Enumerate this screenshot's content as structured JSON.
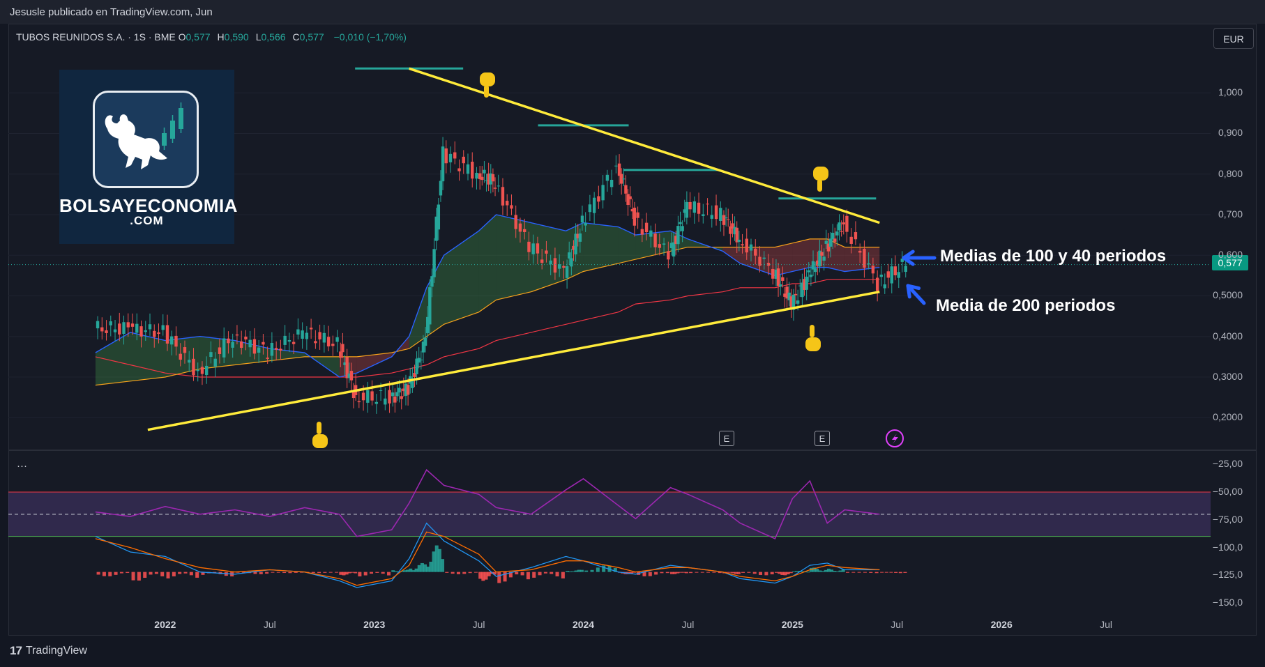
{
  "header": {
    "published": "Jesusle publicado en TradingView.com, Jun",
    "symbol": "TUBOS REUNIDOS S.A. · 1S · BME",
    "ohlc": [
      {
        "label": "O",
        "value": "0,577"
      },
      {
        "label": "H",
        "value": "0,590"
      },
      {
        "label": "L",
        "value": "0,566"
      },
      {
        "label": "C",
        "value": "0,577"
      }
    ],
    "change": "−0,010 (−1,70%)",
    "currency": "EUR"
  },
  "logo": {
    "main": "BOLSAYECONOMIA",
    "sub": ".COM"
  },
  "annotations": {
    "ma_100_40": "Medias de 100 y 40 periodos",
    "ma_200": "Media de 200 periodos"
  },
  "price_badge": "0,577",
  "earnings_marker": "E",
  "footer": {
    "brand": "TradingView"
  },
  "colors": {
    "up": "#26a69a",
    "down": "#ef5350",
    "trendline": "#ffeb3b",
    "ma40": "#2962ff",
    "ma100": "#f7a21b",
    "ma200": "#f23645",
    "rsi": "#9c27b0",
    "macd": "#2196f3",
    "signal": "#ff6d00",
    "annotation_arrow": "#2962ff",
    "resistance": "#26a69a"
  },
  "icons": [
    "bull-logo-icon",
    "pointing-up-hand-icon",
    "pointing-down-hand-icon",
    "arrow-left-icon",
    "lightning-icon",
    "tradingview-logo-icon"
  ],
  "chart_data": [
    {
      "type": "candlestick",
      "timeframe": "1S",
      "price_axis": {
        "ticks": [
          "0,2000",
          "0,3000",
          "0,4000",
          "0,5000",
          "0,600",
          "0,700",
          "0,800",
          "0,900",
          "1,000"
        ],
        "range": [
          0.13,
          1.1
        ]
      },
      "time_axis": {
        "labels": [
          {
            "text": "2022",
            "bold": true
          },
          {
            "text": "Jul",
            "bold": false
          },
          {
            "text": "2023",
            "bold": true
          },
          {
            "text": "Jul",
            "bold": false
          },
          {
            "text": "2024",
            "bold": true
          },
          {
            "text": "Jul",
            "bold": false
          },
          {
            "text": "2025",
            "bold": true
          },
          {
            "text": "Jul",
            "bold": false
          },
          {
            "text": "2026",
            "bold": true
          },
          {
            "text": "Jul",
            "bold": false
          }
        ]
      },
      "series": [
        {
          "name": "Close",
          "x": [
            "2021-09",
            "2021-11",
            "2022-01",
            "2022-03",
            "2022-05",
            "2022-07",
            "2022-09",
            "2022-11",
            "2022-12",
            "2023-02",
            "2023-03",
            "2023-04",
            "2023-05",
            "2023-07",
            "2023-08",
            "2023-10",
            "2023-12",
            "2024-01",
            "2024-03",
            "2024-04",
            "2024-06",
            "2024-07",
            "2024-09",
            "2024-10",
            "2024-12",
            "2025-01",
            "2025-02",
            "2025-03",
            "2025-04",
            "2025-06"
          ],
          "values": [
            0.42,
            0.41,
            0.31,
            0.4,
            0.36,
            0.41,
            0.38,
            0.25,
            0.25,
            0.27,
            0.39,
            0.85,
            0.8,
            0.78,
            0.62,
            0.56,
            0.68,
            0.82,
            0.69,
            0.6,
            0.72,
            0.7,
            0.64,
            0.56,
            0.48,
            0.55,
            0.62,
            0.68,
            0.53,
            0.58
          ]
        }
      ],
      "moving_averages": [
        {
          "period": 40,
          "values": [
            0.36,
            0.41,
            0.39,
            0.4,
            0.39,
            0.37,
            0.36,
            0.3,
            0.31,
            0.35,
            0.4,
            0.52,
            0.6,
            0.66,
            0.7,
            0.68,
            0.66,
            0.68,
            0.67,
            0.65,
            0.66,
            0.64,
            0.61,
            0.58,
            0.55,
            0.56,
            0.57,
            0.57,
            0.56,
            0.57
          ]
        },
        {
          "period": 100,
          "values": [
            0.28,
            0.29,
            0.3,
            0.32,
            0.33,
            0.34,
            0.35,
            0.35,
            0.35,
            0.36,
            0.37,
            0.4,
            0.43,
            0.46,
            0.49,
            0.51,
            0.54,
            0.56,
            0.58,
            0.59,
            0.61,
            0.62,
            0.62,
            0.62,
            0.62,
            0.63,
            0.64,
            0.64,
            0.62,
            0.62
          ]
        },
        {
          "period": 200,
          "values": [
            0.35,
            0.33,
            0.31,
            0.3,
            0.3,
            0.3,
            0.3,
            0.3,
            0.3,
            0.31,
            0.32,
            0.33,
            0.35,
            0.37,
            0.39,
            0.41,
            0.43,
            0.44,
            0.46,
            0.48,
            0.49,
            0.5,
            0.51,
            0.52,
            0.52,
            0.53,
            0.53,
            0.54,
            0.54,
            0.54
          ]
        }
      ],
      "trendlines": [
        {
          "from": [
            "2023-03",
            1.06
          ],
          "to": [
            "2025-06",
            0.68
          ]
        },
        {
          "from": [
            "2021-12",
            0.17
          ],
          "to": [
            "2025-06",
            0.51
          ]
        }
      ],
      "resistance_levels": [
        1.06,
        0.92,
        0.81,
        0.74
      ]
    },
    {
      "type": "line",
      "series": [
        {
          "name": "RSI",
          "values": [
            -68,
            -72,
            -63,
            -70,
            -66,
            -72,
            -64,
            -70,
            -90,
            -84,
            -60,
            -30,
            -44,
            -52,
            -64,
            -70,
            -48,
            -38,
            -62,
            -74,
            -46,
            -52,
            -66,
            -78,
            -92,
            -56,
            -40,
            -78,
            -66,
            -70
          ]
        }
      ],
      "y_axis": {
        "ticks": [
          "−25,00",
          "−50,00",
          "−75,00",
          "−100,0",
          "−125,0",
          "−150,0"
        ],
        "range": [
          -158,
          -18
        ]
      },
      "bands": [
        -50,
        -90
      ],
      "midline": -70
    },
    {
      "type": "line",
      "series": [
        {
          "name": "MACD",
          "values": [
            -90,
            -104,
            -108,
            -122,
            -124,
            -120,
            -122,
            -130,
            -136,
            -130,
            -110,
            -78,
            -94,
            -112,
            -126,
            -118,
            -108,
            -112,
            -122,
            -124,
            -116,
            -118,
            -122,
            -128,
            -132,
            -126,
            -116,
            -114,
            -120,
            -120
          ]
        },
        {
          "name": "Signal",
          "values": [
            -92,
            -100,
            -110,
            -118,
            -122,
            -120,
            -122,
            -128,
            -134,
            -128,
            -116,
            -86,
            -90,
            -106,
            -122,
            -120,
            -112,
            -112,
            -118,
            -122,
            -118,
            -118,
            -122,
            -126,
            -130,
            -126,
            -120,
            -116,
            -118,
            -120
          ]
        }
      ],
      "histogram": [
        -4,
        -8,
        -6,
        -4,
        -2,
        -1,
        -1,
        -3,
        -4,
        2,
        8,
        24,
        -2,
        -8,
        -10,
        -6,
        2,
        6,
        -2,
        -4,
        -2,
        -1,
        -2,
        -3,
        -3,
        1,
        4,
        3,
        -1,
        -1
      ]
    }
  ]
}
